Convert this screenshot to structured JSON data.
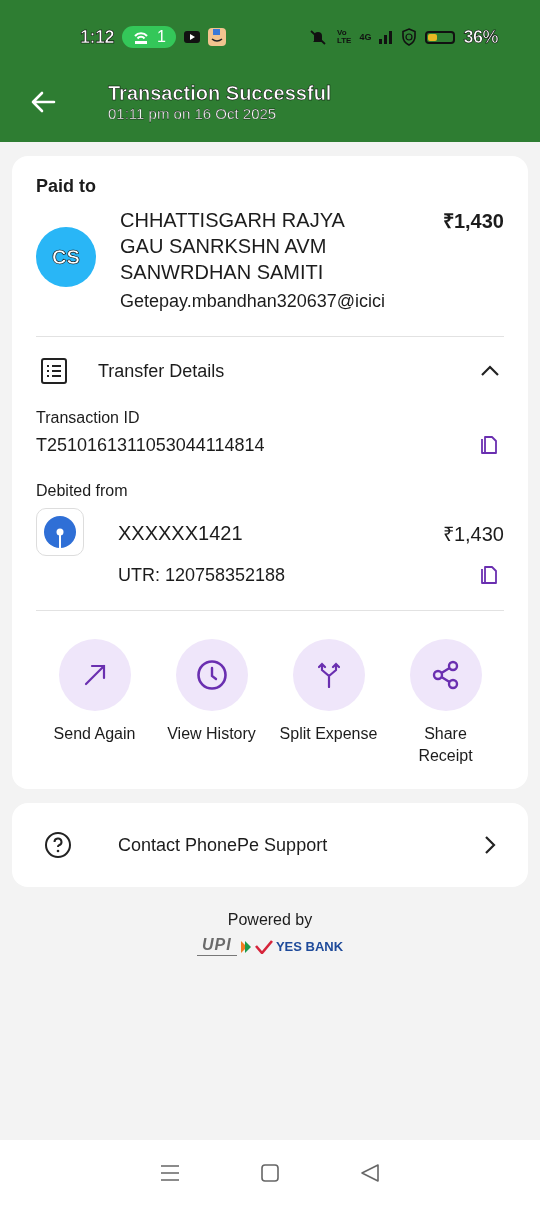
{
  "status_bar": {
    "time": "1:12",
    "hotspot_count": "1",
    "volte": [
      "Vo",
      "LTE"
    ],
    "network": "4G",
    "battery": "36%"
  },
  "header": {
    "title": "Transaction Successful",
    "subtitle": "01:11 pm on 16 Oct 2025"
  },
  "paid_to": {
    "label": "Paid to",
    "initials": "CS",
    "name": "CHHATTISGARH RAJYA GAU SANRKSHN AVM SANWRDHAN SAMITI",
    "amount": "₹1,430",
    "upi_id": "Getepay.mbandhan320637@icici"
  },
  "transfer_details": {
    "title": "Transfer Details",
    "expanded": true,
    "transaction_id_label": "Transaction ID",
    "transaction_id": "T2510161311053044114814",
    "debited_from_label": "Debited from",
    "account": "XXXXXX1421",
    "amount": "₹1,430",
    "utr": "UTR: 120758352188"
  },
  "actions": [
    {
      "kind": "send",
      "label": "Send Again"
    },
    {
      "kind": "history",
      "label": "View History"
    },
    {
      "kind": "split",
      "label": "Split Expense"
    },
    {
      "kind": "share",
      "label": "Share Receipt"
    }
  ],
  "support": {
    "label": "Contact PhonePe Support"
  },
  "footer": {
    "powered_by": "Powered by",
    "upi": "UPI",
    "bank": "YES BANK"
  }
}
